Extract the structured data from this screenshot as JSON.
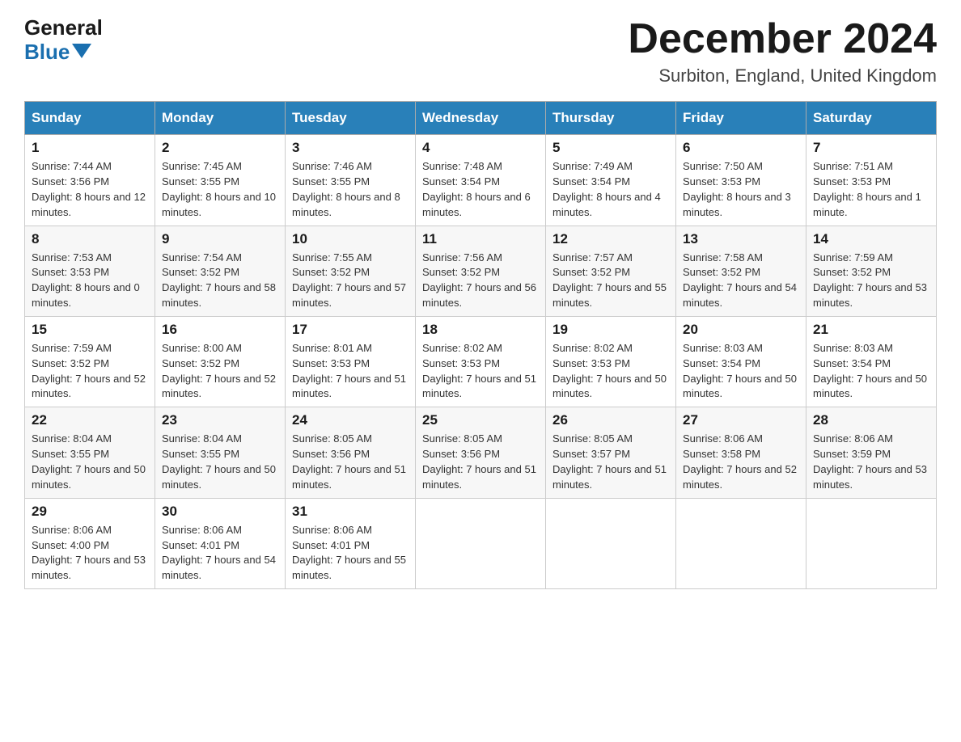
{
  "header": {
    "logo_general": "General",
    "logo_blue": "Blue",
    "month_title": "December 2024",
    "location": "Surbiton, England, United Kingdom"
  },
  "days_of_week": [
    "Sunday",
    "Monday",
    "Tuesday",
    "Wednesday",
    "Thursday",
    "Friday",
    "Saturday"
  ],
  "weeks": [
    [
      {
        "day": "1",
        "sunrise": "Sunrise: 7:44 AM",
        "sunset": "Sunset: 3:56 PM",
        "daylight": "Daylight: 8 hours and 12 minutes."
      },
      {
        "day": "2",
        "sunrise": "Sunrise: 7:45 AM",
        "sunset": "Sunset: 3:55 PM",
        "daylight": "Daylight: 8 hours and 10 minutes."
      },
      {
        "day": "3",
        "sunrise": "Sunrise: 7:46 AM",
        "sunset": "Sunset: 3:55 PM",
        "daylight": "Daylight: 8 hours and 8 minutes."
      },
      {
        "day": "4",
        "sunrise": "Sunrise: 7:48 AM",
        "sunset": "Sunset: 3:54 PM",
        "daylight": "Daylight: 8 hours and 6 minutes."
      },
      {
        "day": "5",
        "sunrise": "Sunrise: 7:49 AM",
        "sunset": "Sunset: 3:54 PM",
        "daylight": "Daylight: 8 hours and 4 minutes."
      },
      {
        "day": "6",
        "sunrise": "Sunrise: 7:50 AM",
        "sunset": "Sunset: 3:53 PM",
        "daylight": "Daylight: 8 hours and 3 minutes."
      },
      {
        "day": "7",
        "sunrise": "Sunrise: 7:51 AM",
        "sunset": "Sunset: 3:53 PM",
        "daylight": "Daylight: 8 hours and 1 minute."
      }
    ],
    [
      {
        "day": "8",
        "sunrise": "Sunrise: 7:53 AM",
        "sunset": "Sunset: 3:53 PM",
        "daylight": "Daylight: 8 hours and 0 minutes."
      },
      {
        "day": "9",
        "sunrise": "Sunrise: 7:54 AM",
        "sunset": "Sunset: 3:52 PM",
        "daylight": "Daylight: 7 hours and 58 minutes."
      },
      {
        "day": "10",
        "sunrise": "Sunrise: 7:55 AM",
        "sunset": "Sunset: 3:52 PM",
        "daylight": "Daylight: 7 hours and 57 minutes."
      },
      {
        "day": "11",
        "sunrise": "Sunrise: 7:56 AM",
        "sunset": "Sunset: 3:52 PM",
        "daylight": "Daylight: 7 hours and 56 minutes."
      },
      {
        "day": "12",
        "sunrise": "Sunrise: 7:57 AM",
        "sunset": "Sunset: 3:52 PM",
        "daylight": "Daylight: 7 hours and 55 minutes."
      },
      {
        "day": "13",
        "sunrise": "Sunrise: 7:58 AM",
        "sunset": "Sunset: 3:52 PM",
        "daylight": "Daylight: 7 hours and 54 minutes."
      },
      {
        "day": "14",
        "sunrise": "Sunrise: 7:59 AM",
        "sunset": "Sunset: 3:52 PM",
        "daylight": "Daylight: 7 hours and 53 minutes."
      }
    ],
    [
      {
        "day": "15",
        "sunrise": "Sunrise: 7:59 AM",
        "sunset": "Sunset: 3:52 PM",
        "daylight": "Daylight: 7 hours and 52 minutes."
      },
      {
        "day": "16",
        "sunrise": "Sunrise: 8:00 AM",
        "sunset": "Sunset: 3:52 PM",
        "daylight": "Daylight: 7 hours and 52 minutes."
      },
      {
        "day": "17",
        "sunrise": "Sunrise: 8:01 AM",
        "sunset": "Sunset: 3:53 PM",
        "daylight": "Daylight: 7 hours and 51 minutes."
      },
      {
        "day": "18",
        "sunrise": "Sunrise: 8:02 AM",
        "sunset": "Sunset: 3:53 PM",
        "daylight": "Daylight: 7 hours and 51 minutes."
      },
      {
        "day": "19",
        "sunrise": "Sunrise: 8:02 AM",
        "sunset": "Sunset: 3:53 PM",
        "daylight": "Daylight: 7 hours and 50 minutes."
      },
      {
        "day": "20",
        "sunrise": "Sunrise: 8:03 AM",
        "sunset": "Sunset: 3:54 PM",
        "daylight": "Daylight: 7 hours and 50 minutes."
      },
      {
        "day": "21",
        "sunrise": "Sunrise: 8:03 AM",
        "sunset": "Sunset: 3:54 PM",
        "daylight": "Daylight: 7 hours and 50 minutes."
      }
    ],
    [
      {
        "day": "22",
        "sunrise": "Sunrise: 8:04 AM",
        "sunset": "Sunset: 3:55 PM",
        "daylight": "Daylight: 7 hours and 50 minutes."
      },
      {
        "day": "23",
        "sunrise": "Sunrise: 8:04 AM",
        "sunset": "Sunset: 3:55 PM",
        "daylight": "Daylight: 7 hours and 50 minutes."
      },
      {
        "day": "24",
        "sunrise": "Sunrise: 8:05 AM",
        "sunset": "Sunset: 3:56 PM",
        "daylight": "Daylight: 7 hours and 51 minutes."
      },
      {
        "day": "25",
        "sunrise": "Sunrise: 8:05 AM",
        "sunset": "Sunset: 3:56 PM",
        "daylight": "Daylight: 7 hours and 51 minutes."
      },
      {
        "day": "26",
        "sunrise": "Sunrise: 8:05 AM",
        "sunset": "Sunset: 3:57 PM",
        "daylight": "Daylight: 7 hours and 51 minutes."
      },
      {
        "day": "27",
        "sunrise": "Sunrise: 8:06 AM",
        "sunset": "Sunset: 3:58 PM",
        "daylight": "Daylight: 7 hours and 52 minutes."
      },
      {
        "day": "28",
        "sunrise": "Sunrise: 8:06 AM",
        "sunset": "Sunset: 3:59 PM",
        "daylight": "Daylight: 7 hours and 53 minutes."
      }
    ],
    [
      {
        "day": "29",
        "sunrise": "Sunrise: 8:06 AM",
        "sunset": "Sunset: 4:00 PM",
        "daylight": "Daylight: 7 hours and 53 minutes."
      },
      {
        "day": "30",
        "sunrise": "Sunrise: 8:06 AM",
        "sunset": "Sunset: 4:01 PM",
        "daylight": "Daylight: 7 hours and 54 minutes."
      },
      {
        "day": "31",
        "sunrise": "Sunrise: 8:06 AM",
        "sunset": "Sunset: 4:01 PM",
        "daylight": "Daylight: 7 hours and 55 minutes."
      },
      null,
      null,
      null,
      null
    ]
  ]
}
